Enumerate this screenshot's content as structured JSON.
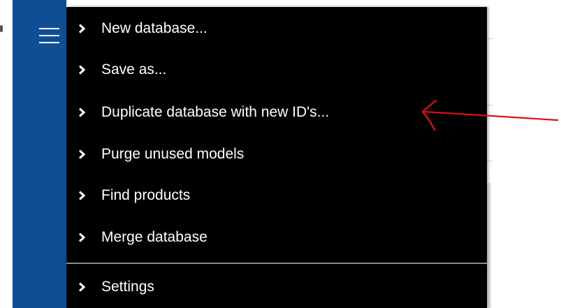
{
  "menu": {
    "items": [
      {
        "label": "New database..."
      },
      {
        "label": "Save as..."
      },
      {
        "label": "Duplicate database with new ID's..."
      },
      {
        "label": "Purge unused models"
      },
      {
        "label": "Find products"
      },
      {
        "label": "Merge database"
      }
    ],
    "settings_label": "Settings"
  },
  "icons": {
    "menu_toggle": "hamburger-icon",
    "item_marker": "chevron-right-icon",
    "annotation": "red-arrow-icon"
  },
  "colors": {
    "rail": "#0d4e94",
    "menu_background": "#000000",
    "menu_text": "#ffffff",
    "annotation": "#e01010"
  }
}
